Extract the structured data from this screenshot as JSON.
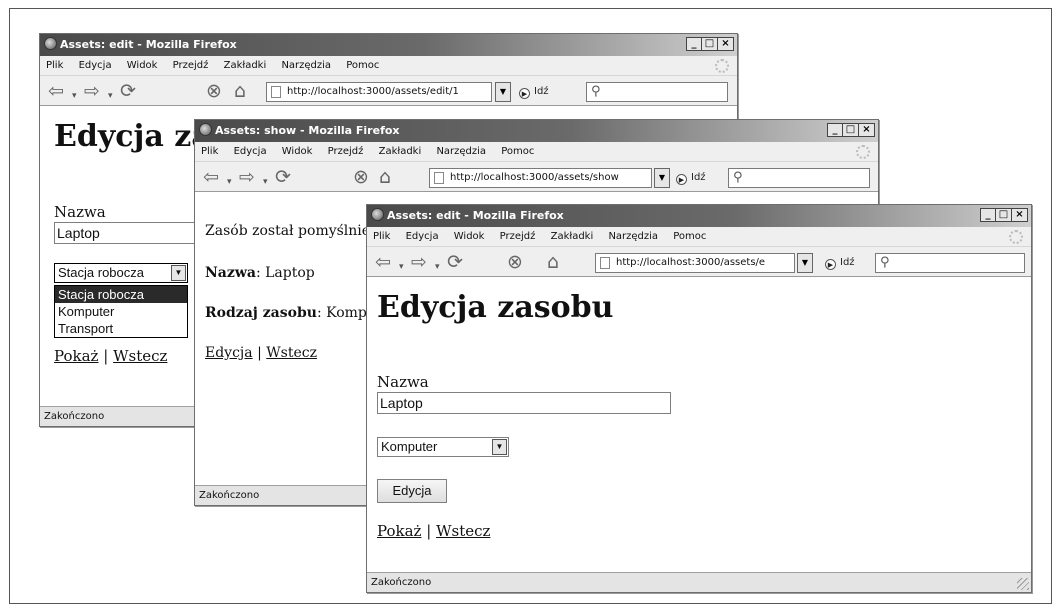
{
  "windows": {
    "back": {
      "title": "Assets: edit - Mozilla Firefox",
      "menu": [
        "Plik",
        "Edycja",
        "Widok",
        "Przejdź",
        "Zakładki",
        "Narzędzia",
        "Pomoc"
      ],
      "url": "http://localhost:3000/assets/edit/1",
      "go_label": "Idź",
      "heading": "Edycja za",
      "name_label": "Nazwa",
      "name_value": "Laptop",
      "select_value": "Stacja robocza",
      "options": [
        "Stacja robocza",
        "Komputer",
        "Transport"
      ],
      "link_show": "Pokaż",
      "link_sep": "|",
      "link_back": "Wstecz",
      "status": "Zakończono"
    },
    "middle": {
      "title": "Assets: show - Mozilla Firefox",
      "menu": [
        "Plik",
        "Edycja",
        "Widok",
        "Przejdź",
        "Zakładki",
        "Narzędzia",
        "Pomoc"
      ],
      "url": "http://localhost:3000/assets/show",
      "go_label": "Idź",
      "notice": "Zasób został pomyślnie",
      "name_label": "Nazwa",
      "name_value": ": Laptop",
      "type_label": "Rodzaj zasobu",
      "type_value": ": Komp",
      "link_edit": "Edycja",
      "link_sep": "|",
      "link_back": "Wstecz",
      "status": "Zakończono"
    },
    "front": {
      "title": "Assets: edit - Mozilla Firefox",
      "menu": [
        "Plik",
        "Edycja",
        "Widok",
        "Przejdź",
        "Zakładki",
        "Narzędzia",
        "Pomoc"
      ],
      "url": "http://localhost:3000/assets/e",
      "go_label": "Idź",
      "heading": "Edycja zasobu",
      "name_label": "Nazwa",
      "name_value": "Laptop",
      "select_value": "Komputer",
      "submit_label": "Edycja",
      "link_show": "Pokaż",
      "link_sep": "|",
      "link_back": "Wstecz",
      "status": "Zakończono"
    }
  },
  "icons": [
    "firefox-icon",
    "back-arrow-icon",
    "forward-arrow-icon",
    "reload-icon",
    "stop-icon",
    "home-icon",
    "page-icon",
    "go-icon",
    "search-icon",
    "throbber-icon",
    "minimize-icon",
    "maximize-icon",
    "close-icon",
    "resize-grip-icon"
  ]
}
